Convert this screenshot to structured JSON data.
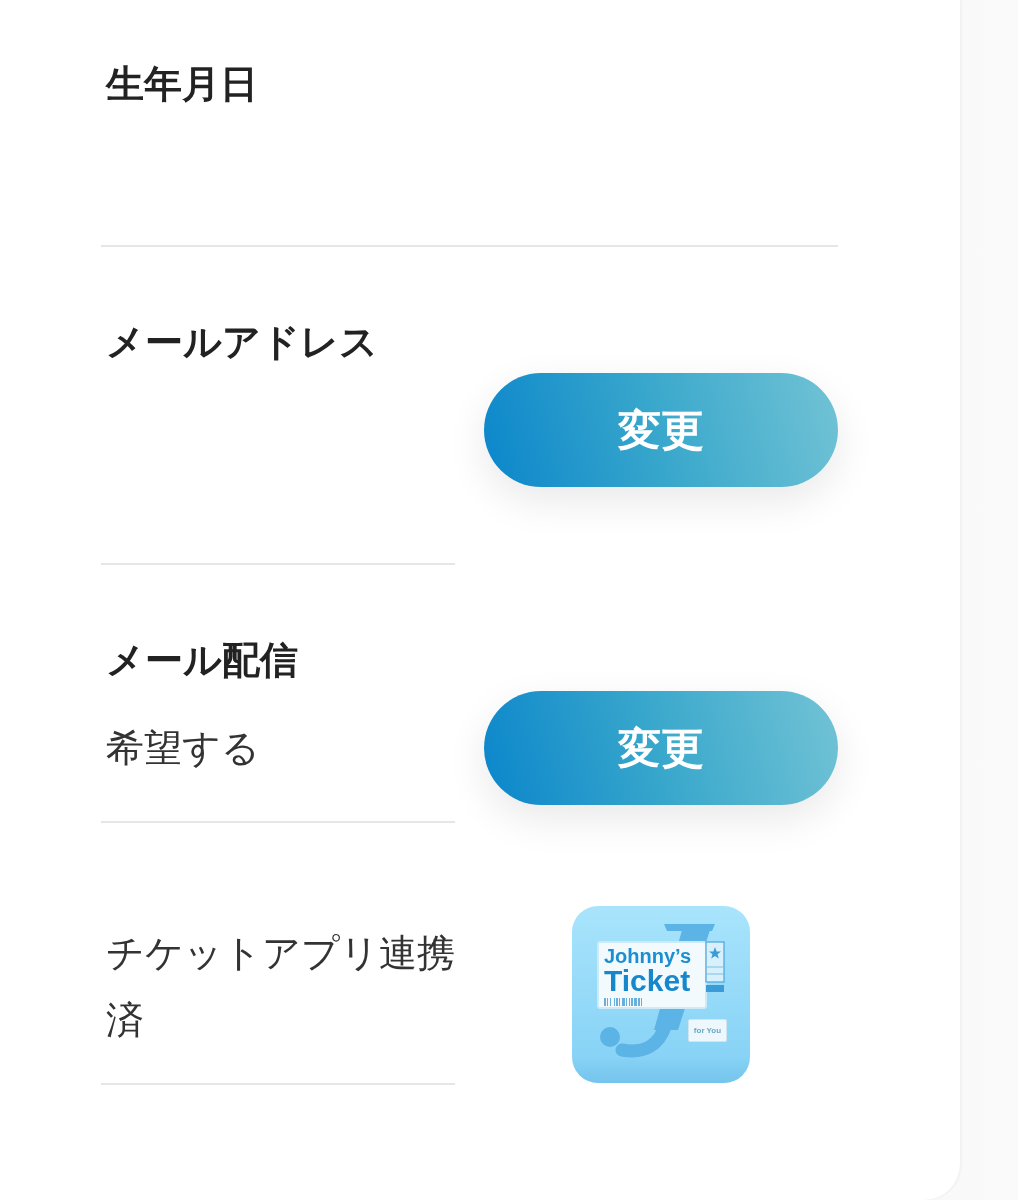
{
  "rows": [
    {
      "kind": "field",
      "label": "生年月日"
    },
    {
      "kind": "field",
      "label": "メールアドレス",
      "button": "変更"
    },
    {
      "kind": "field",
      "label": "メール配信",
      "value": "希望する",
      "button": "変更"
    },
    {
      "kind": "app_link",
      "value": "チケットアプリ連携済",
      "app_logo": {
        "lines": [
          "Johnny’s",
          "Ticket"
        ],
        "tag": "for You"
      }
    }
  ]
}
